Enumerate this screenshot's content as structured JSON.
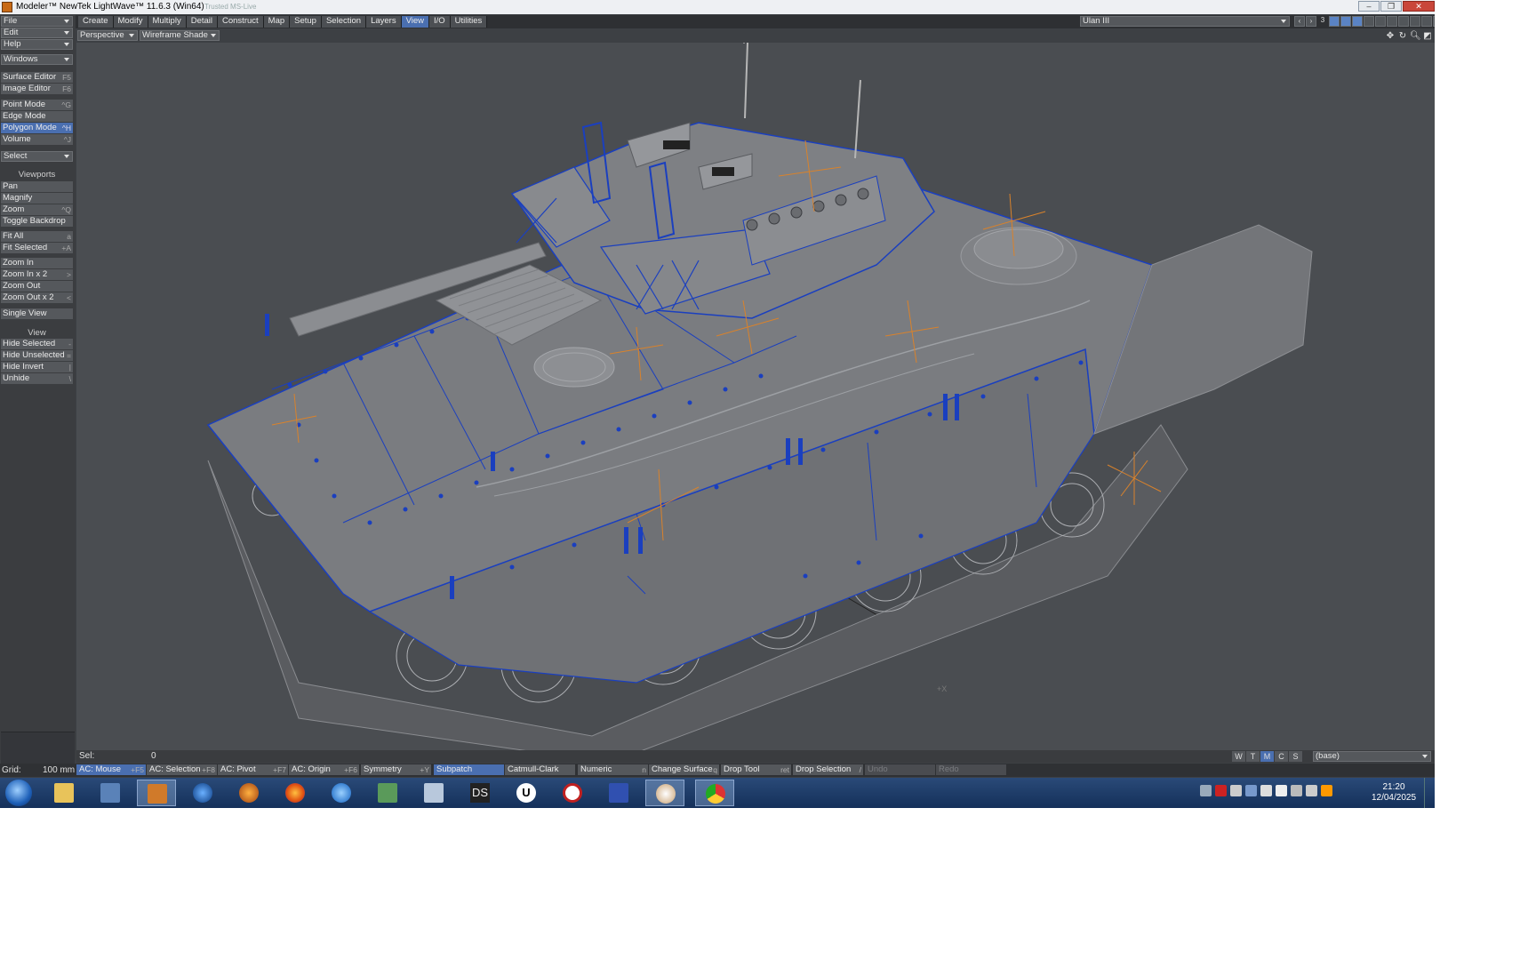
{
  "window": {
    "title": "Modeler™ NewTek LightWave™ 11.6.3 (Win64)",
    "ghost_text": "Trusted MS-Live"
  },
  "menubar": {
    "file": "File",
    "tabs": [
      "Create",
      "Modify",
      "Multiply",
      "Detail",
      "Construct",
      "Map",
      "Setup",
      "Selection",
      "Layers",
      "View",
      "I/O",
      "Utilities"
    ],
    "active_tab": "View",
    "object_name": "Ulan III",
    "layer_number": "3"
  },
  "left_panel": {
    "edit": "Edit",
    "help": "Help",
    "windows": "Windows",
    "surface_editor": {
      "label": "Surface Editor",
      "key": "F5"
    },
    "image_editor": {
      "label": "Image Editor",
      "key": "F6"
    },
    "point_mode": {
      "label": "Point Mode",
      "key": "^G"
    },
    "edge_mode": {
      "label": "Edge Mode",
      "key": ""
    },
    "polygon_mode": {
      "label": "Polygon Mode",
      "key": "^H"
    },
    "volume": {
      "label": "Volume",
      "key": "^J"
    },
    "select": "Select",
    "viewports_header": "Viewports",
    "pan": "Pan",
    "magnify": "Magnify",
    "zoom": {
      "label": "Zoom",
      "key": "^Q"
    },
    "toggle_backdrop": "Toggle Backdrop",
    "fit_all": {
      "label": "Fit All",
      "key": "a"
    },
    "fit_selected": {
      "label": "Fit Selected",
      "key": "+A"
    },
    "zoom_in": "Zoom In",
    "zoom_in_x2": {
      "label": "Zoom In x 2",
      "key": ">"
    },
    "zoom_out": "Zoom Out",
    "zoom_out_x2": {
      "label": "Zoom Out x 2",
      "key": "<"
    },
    "single_view": "Single View",
    "view_header": "View",
    "hide_selected": {
      "label": "Hide Selected",
      "key": "-"
    },
    "hide_unselected": {
      "label": "Hide Unselected",
      "key": "="
    },
    "hide_invert": {
      "label": "Hide Invert",
      "key": "|"
    },
    "unhide": {
      "label": "Unhide",
      "key": "\\"
    }
  },
  "viewport": {
    "view": "Perspective",
    "shading": "Wireframe Shade",
    "axis_label": "+X"
  },
  "status": {
    "sel_label": "Sel:",
    "sel_value": "0",
    "vis": [
      "W",
      "T",
      "M",
      "C",
      "S"
    ],
    "vis_active": "M",
    "layer": "(base)"
  },
  "toolbar": {
    "grid_label": "Grid:",
    "grid_value": "100 mm",
    "ac_mouse": {
      "label": "AC: Mouse",
      "key": "+F5"
    },
    "ac_selection": {
      "label": "AC: Selection",
      "key": "+F8"
    },
    "ac_pivot": {
      "label": "AC: Pivot",
      "key": "+F7"
    },
    "ac_origin": {
      "label": "AC: Origin",
      "key": "+F6"
    },
    "symmetry": {
      "label": "Symmetry",
      "key": "+Y"
    },
    "subpatch": "Subpatch",
    "catmull": "Catmull-Clark",
    "numeric": {
      "label": "Numeric",
      "key": "n"
    },
    "change_surface": {
      "label": "Change Surface",
      "key": "q"
    },
    "drop_tool": {
      "label": "Drop Tool",
      "key": "ret"
    },
    "drop_selection": {
      "label": "Drop Selection",
      "key": "/"
    },
    "undo": "Undo",
    "redo": "Redo"
  },
  "taskbar": {
    "apps": [
      "explorer",
      "lightwave-layout",
      "lightwave-modeler",
      "blender-like",
      "lightwave-hub",
      "firefox",
      "thunderbird",
      "network-monitor",
      "calculator",
      "daz-studio",
      "unity",
      "acrobat",
      "app-z",
      "paint",
      "chrome"
    ],
    "ds_label": "DS",
    "u_label": "U",
    "time": "21:20",
    "date": "12/04/2025"
  },
  "colors": {
    "accent": "#4a6fb0",
    "wire": "#1a3fbf",
    "pivot": "#d9822b",
    "background": "#4a4d51"
  }
}
